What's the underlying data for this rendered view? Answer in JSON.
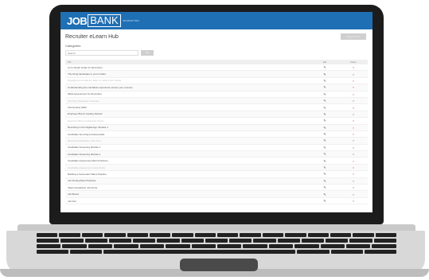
{
  "app": {
    "logo_primary": "JOB",
    "logo_secondary": "BANK",
    "logo_tagline": "MARKETING"
  },
  "page": {
    "title": "Recruiter eLearn Hub",
    "export_label": "Export CSV",
    "category_label": "Categories",
    "search_placeholder": "Search",
    "search_button": "Go"
  },
  "table": {
    "headers": {
      "title": "Title",
      "edit": "Edit",
      "delete": "Delete"
    },
    "edit_icon": "pencil-icon",
    "delete_icon": "cross-icon",
    "rows": [
      {
        "title": "An In-Depth Guide for Recruiters",
        "faint": false
      },
      {
        "title": "The hiring landscape in your market",
        "faint": false
      },
      {
        "title": "Engaging and retaining talent in today's job market",
        "faint": true
      },
      {
        "title": "Understanding the candidate experience across your process",
        "faint": false
      },
      {
        "title": "Skills Assessment for Recruiters",
        "faint": false
      },
      {
        "title": "Sourcing Strategies Overview",
        "faint": true
      },
      {
        "title": "Interviewing Skills",
        "faint": false
      },
      {
        "title": "Employer Brand: Getting Started",
        "faint": false
      },
      {
        "title": "Employer Brand: Advanced Topics",
        "faint": true
      },
      {
        "title": "Recruiting in the Digital Age: Module 1",
        "faint": false
      },
      {
        "title": "Candidate Sourcing Fundamentals",
        "faint": false
      },
      {
        "title": "Recruiting Strategies: Part One",
        "faint": true
      },
      {
        "title": "Candidate Screening Module 1",
        "faint": false
      },
      {
        "title": "Candidate Screening Module 2",
        "faint": false
      },
      {
        "title": "Candidate Assessment Best Practices",
        "faint": false
      },
      {
        "title": "Candidate Assessment Case Study",
        "faint": true
      },
      {
        "title": "Building a Successful Talent Pipeline",
        "faint": false
      },
      {
        "title": "Job Posting Best Practices",
        "faint": false
      },
      {
        "title": "Talent Acquisition Job Posts",
        "faint": false
      },
      {
        "title": "Job Board",
        "faint": false
      },
      {
        "title": "Job Fair",
        "faint": false
      }
    ]
  }
}
